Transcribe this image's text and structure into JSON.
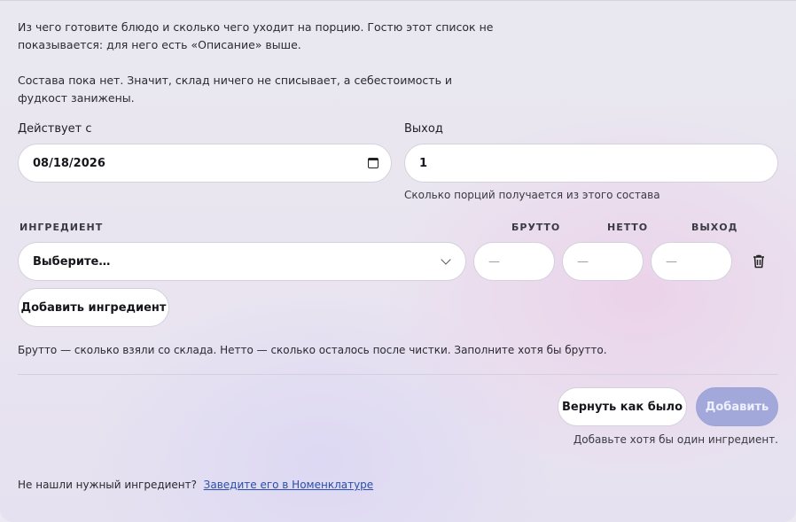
{
  "intro": {
    "line1": "Из чего готовите блюдо и сколько чего уходит на порцию. Гостю этот список не",
    "line2": "показывается: для него есть «Описание» выше.",
    "warning1": "Состава пока нет. Значит, склад ничего не списывает, а себестоимость и",
    "warning2": "фудкост занижены."
  },
  "effective": {
    "label": "Действует с",
    "value": "08/18/2026"
  },
  "yield": {
    "label": "Выход",
    "value": "1",
    "hint": "Сколько порций получается из этого состава"
  },
  "table": {
    "col_ingredient": "ИНГРЕДИЕНТ",
    "col_gross": "БРУТТО",
    "col_net": "НЕТТО",
    "col_yield": "ВЫХОД",
    "row": {
      "ingredient": "Выберите…",
      "gross": "—",
      "net": "—",
      "yield": "—"
    }
  },
  "add_ingredient_label": "Добавить ингредиент",
  "gross_net_hint": "Брутто — сколько взяли со склада. Нетто — сколько осталось после чистки. Заполните хотя бы брутто.",
  "actions": {
    "revert_label": "Вернуть как было",
    "submit_label": "Добавить",
    "submit_hint": "Добавьте хотя бы один ингредиент."
  },
  "footer": {
    "question": "Не нашли нужный ингредиент?",
    "link": "Заведите его в Номенклатуре"
  },
  "colors": {
    "accent_disabled": "#a3a8da",
    "link": "#2a4fa8"
  },
  "icons": {
    "date": "calendar-icon",
    "select": "chevron-down-icon",
    "delete": "trash-icon"
  }
}
